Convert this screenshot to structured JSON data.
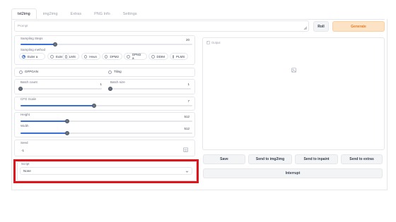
{
  "tabs": [
    "txt2img",
    "img2img",
    "Extras",
    "PNG Info",
    "Settings"
  ],
  "prompt": {
    "placeholder": "Prompt"
  },
  "buttons": {
    "roll": "Roll",
    "generate": "Generate",
    "save": "Save",
    "send_img2img": "Send to img2img",
    "send_inpaint": "Send to inpaint",
    "send_extras": "Send to extras",
    "interrupt": "Interrupt"
  },
  "sampling_steps": {
    "label": "Sampling Steps",
    "value": "20",
    "fraction": 0.2
  },
  "sampling_method": {
    "label": "Sampling method",
    "options": [
      "Euler a",
      "Euler",
      "LMS",
      "Heun",
      "DPM2",
      "DPM2 a",
      "DDIM",
      "PLMS"
    ],
    "selected": "Euler a"
  },
  "gfpgan": {
    "label": "GFPGAN"
  },
  "tiling": {
    "label": "Tiling"
  },
  "batch_count": {
    "label": "Batch count",
    "value": "1",
    "fraction": 0.0
  },
  "batch_size": {
    "label": "Batch size",
    "value": "1",
    "fraction": 0.0
  },
  "cfg_scale": {
    "label": "CFG Scale",
    "value": "7",
    "fraction": 0.43
  },
  "height": {
    "label": "Height",
    "value": "512",
    "fraction": 0.27
  },
  "width": {
    "label": "Width",
    "value": "512",
    "fraction": 0.27
  },
  "seed": {
    "label": "Seed",
    "value": "-1"
  },
  "script": {
    "label": "Script",
    "selected": "None"
  },
  "output": {
    "label": "Output"
  },
  "colors": {
    "accent": "#3b6fd8",
    "generate_bg": "#fde3c6",
    "generate_text": "#ea7b1f",
    "highlight": "#e0151b"
  }
}
